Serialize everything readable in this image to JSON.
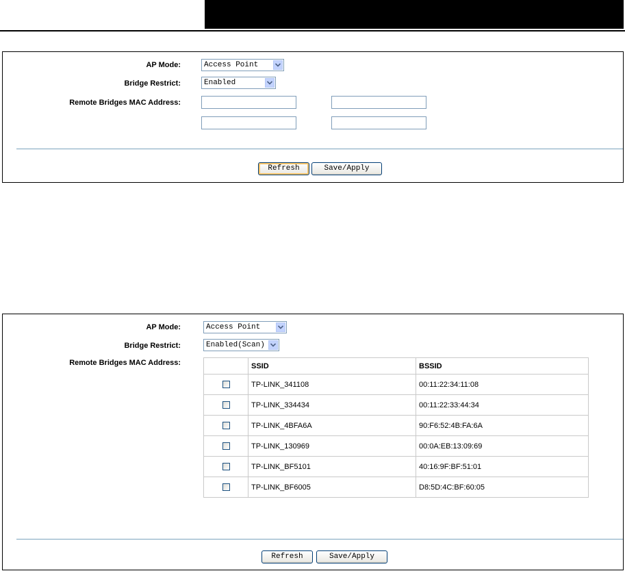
{
  "panel1": {
    "ap_mode": {
      "label": "AP Mode:",
      "value": "Access Point"
    },
    "bridge_restrict": {
      "label": "Bridge Restrict:",
      "value": "Enabled"
    },
    "remote_mac": {
      "label": "Remote Bridges MAC Address:",
      "fields": [
        "",
        "",
        "",
        ""
      ]
    },
    "buttons": {
      "refresh": "Refresh",
      "save": "Save/Apply"
    }
  },
  "panel2": {
    "ap_mode": {
      "label": "AP Mode:",
      "value": "Access Point"
    },
    "bridge_restrict": {
      "label": "Bridge Restrict:",
      "value": "Enabled(Scan)"
    },
    "remote_mac": {
      "label": "Remote Bridges MAC Address:"
    },
    "table": {
      "headers": [
        "",
        "SSID",
        "BSSID"
      ],
      "rows": [
        {
          "ssid": "TP-LINK_341108",
          "bssid": "00:11:22:34:11:08",
          "checked": false
        },
        {
          "ssid": "TP-LINK_334434",
          "bssid": "00:11:22:33:44:34",
          "checked": false
        },
        {
          "ssid": "TP-LINK_4BFA6A",
          "bssid": "90:F6:52:4B:FA:6A",
          "checked": false
        },
        {
          "ssid": "TP-LINK_130969",
          "bssid": "00:0A:EB:13:09:69",
          "checked": false
        },
        {
          "ssid": "TP-LINK_BF5101",
          "bssid": "40:16:9F:BF:51:01",
          "checked": false
        },
        {
          "ssid": "TP-LINK_BF6005",
          "bssid": "D8:5D:4C:BF:60:05",
          "checked": false
        }
      ]
    },
    "buttons": {
      "refresh": "Refresh",
      "save": "Save/Apply"
    }
  },
  "colors": {
    "separator": "#7aa3bd",
    "header": "#000000",
    "focus_ring": "#f6c46b"
  }
}
